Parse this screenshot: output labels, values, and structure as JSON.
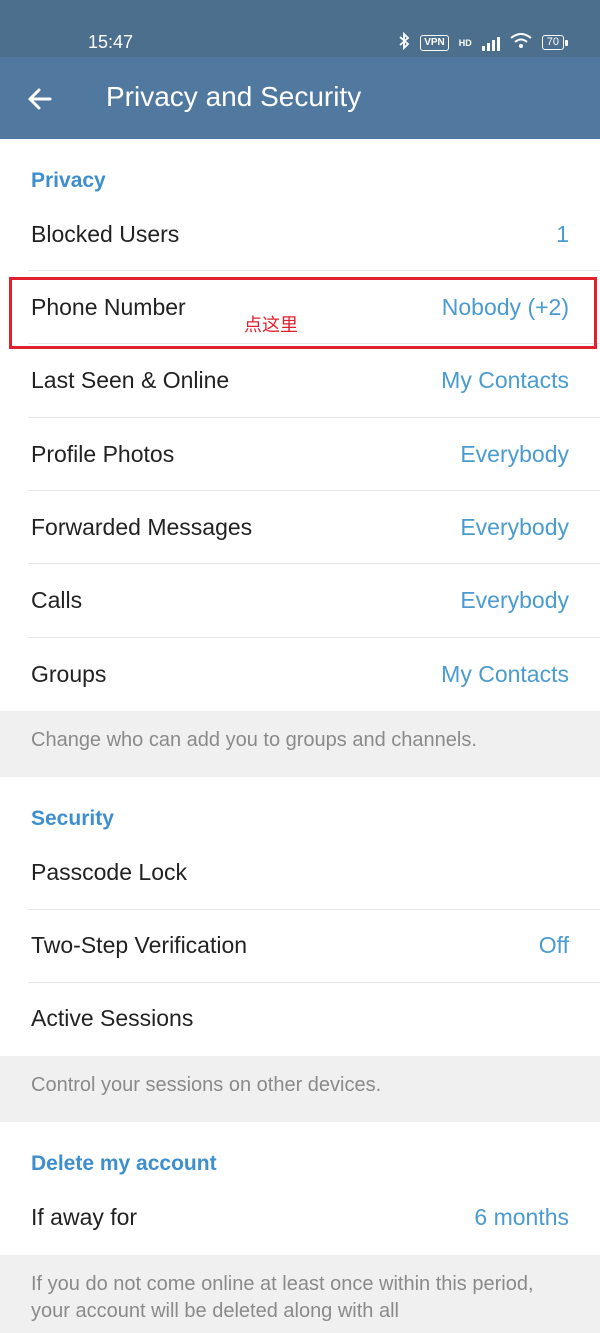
{
  "status_bar": {
    "time": "15:47",
    "vpn": "VPN",
    "hd": "HD",
    "battery": "70"
  },
  "app_bar": {
    "back_icon": "arrow-left-icon",
    "title": "Privacy and Security"
  },
  "privacy": {
    "header": "Privacy",
    "rows": [
      {
        "label": "Blocked Users",
        "value": "1"
      },
      {
        "label": "Phone Number",
        "value": "Nobody (+2)"
      },
      {
        "label": "Last Seen & Online",
        "value": "My Contacts"
      },
      {
        "label": "Profile Photos",
        "value": "Everybody"
      },
      {
        "label": "Forwarded Messages",
        "value": "Everybody"
      },
      {
        "label": "Calls",
        "value": "Everybody"
      },
      {
        "label": "Groups",
        "value": "My Contacts"
      }
    ],
    "note": "Change who can add you to groups and channels."
  },
  "annotation": "点这里",
  "security": {
    "header": "Security",
    "rows": [
      {
        "label": "Passcode Lock",
        "value": ""
      },
      {
        "label": "Two-Step Verification",
        "value": "Off"
      },
      {
        "label": "Active Sessions",
        "value": ""
      }
    ],
    "note": "Control your sessions on other devices."
  },
  "delete_account": {
    "header": "Delete my account",
    "rows": [
      {
        "label": "If away for",
        "value": "6 months"
      }
    ],
    "note": "If you do not come online at least once within this period, your account will be deleted along with all"
  },
  "colors": {
    "status_bar": "#4c6f8e",
    "app_bar": "#5179a0",
    "accent": "#3d8fcf",
    "value": "#4a9bd0",
    "highlight": "#e0202c"
  }
}
